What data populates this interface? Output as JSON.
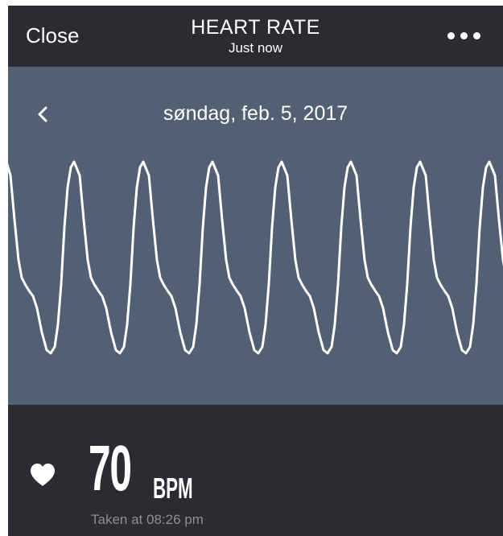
{
  "navbar": {
    "close_label": "Close",
    "title": "HEART RATE",
    "subtitle": "Just now",
    "more_icon": "ellipsis-icon"
  },
  "graph": {
    "date": "søndag, feb. 5, 2017",
    "back_icon": "chevron-left-icon",
    "background_color": "#526073",
    "line_color": "#ffffff",
    "beats_visible": 7
  },
  "reading": {
    "icon": "heart-icon",
    "value": "70",
    "unit": "BPM",
    "taken_at": "Taken at 08:26 pm"
  },
  "colors": {
    "bar_background": "#2b2c31",
    "text_primary": "#ffffff",
    "text_secondary": "#8d8f94"
  }
}
